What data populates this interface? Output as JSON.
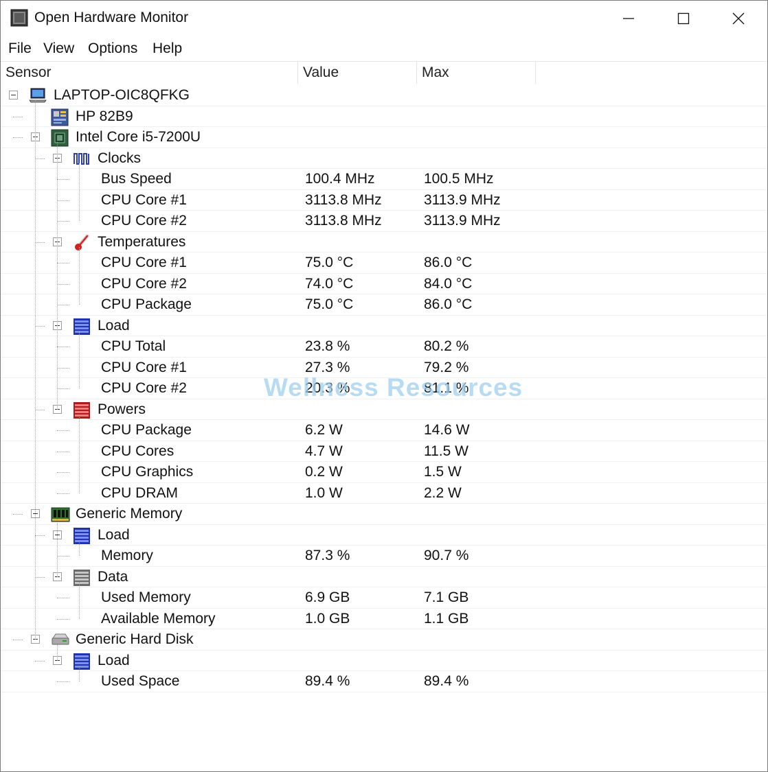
{
  "window": {
    "title": "Open Hardware Monitor",
    "controls": {
      "minimize": "minimize",
      "maximize": "maximize",
      "close": "close"
    }
  },
  "menu": [
    "File",
    "View",
    "Options",
    "Help"
  ],
  "columns": [
    "Sensor",
    "Value",
    "Max"
  ],
  "tree": [
    {
      "label": "LAPTOP-OIC8QFKG",
      "icon": "computer-icon",
      "level": 0,
      "expandable": true
    },
    {
      "label": "HP 82B9",
      "icon": "motherboard-icon",
      "level": 1,
      "expandable": false
    },
    {
      "label": "Intel Core i5-7200U",
      "icon": "cpu-chip-icon",
      "level": 1,
      "expandable": true
    },
    {
      "label": "Clocks",
      "icon": "clock-wave-icon",
      "level": 2,
      "expandable": true
    },
    {
      "label": "Bus Speed",
      "level": 3,
      "value": "100.4 MHz",
      "max": "100.5 MHz"
    },
    {
      "label": "CPU Core #1",
      "level": 3,
      "value": "3113.8 MHz",
      "max": "3113.9 MHz"
    },
    {
      "label": "CPU Core #2",
      "level": 3,
      "value": "3113.8 MHz",
      "max": "3113.9 MHz"
    },
    {
      "label": "Temperatures",
      "icon": "thermometer-icon",
      "level": 2,
      "expandable": true
    },
    {
      "label": "CPU Core #1",
      "level": 3,
      "value": "75.0 °C",
      "max": "86.0 °C"
    },
    {
      "label": "CPU Core #2",
      "level": 3,
      "value": "74.0 °C",
      "max": "84.0 °C"
    },
    {
      "label": "CPU Package",
      "level": 3,
      "value": "75.0 °C",
      "max": "86.0 °C"
    },
    {
      "label": "Load",
      "icon": "load-bars-blue-icon",
      "level": 2,
      "expandable": true
    },
    {
      "label": "CPU Total",
      "level": 3,
      "value": "23.8 %",
      "max": "80.2 %"
    },
    {
      "label": "CPU Core #1",
      "level": 3,
      "value": "27.3 %",
      "max": "79.2 %"
    },
    {
      "label": "CPU Core #2",
      "level": 3,
      "value": "20.3 %",
      "max": "81.1 %"
    },
    {
      "label": "Powers",
      "icon": "power-bars-red-icon",
      "level": 2,
      "expandable": true
    },
    {
      "label": "CPU Package",
      "level": 3,
      "value": "6.2 W",
      "max": "14.6 W"
    },
    {
      "label": "CPU Cores",
      "level": 3,
      "value": "4.7 W",
      "max": "11.5 W"
    },
    {
      "label": "CPU Graphics",
      "level": 3,
      "value": "0.2 W",
      "max": "1.5 W"
    },
    {
      "label": "CPU DRAM",
      "level": 3,
      "value": "1.0 W",
      "max": "2.2 W"
    },
    {
      "label": "Generic Memory",
      "icon": "ram-module-icon",
      "level": 1,
      "expandable": true
    },
    {
      "label": "Load",
      "icon": "load-bars-blue-icon",
      "level": 2,
      "expandable": true
    },
    {
      "label": "Memory",
      "level": 3,
      "value": "87.3 %",
      "max": "90.7 %"
    },
    {
      "label": "Data",
      "icon": "data-bars-gray-icon",
      "level": 2,
      "expandable": true
    },
    {
      "label": "Used Memory",
      "level": 3,
      "value": "6.9 GB",
      "max": "7.1 GB"
    },
    {
      "label": "Available Memory",
      "level": 3,
      "value": "1.0 GB",
      "max": "1.1 GB"
    },
    {
      "label": "Generic Hard Disk",
      "icon": "hard-disk-icon",
      "level": 1,
      "expandable": true
    },
    {
      "label": "Load",
      "icon": "load-bars-blue-icon",
      "level": 2,
      "expandable": true
    },
    {
      "label": "Used Space",
      "level": 3,
      "value": "89.4 %",
      "max": "89.4 %"
    }
  ],
  "watermark": "Wellness Resources",
  "colors": {
    "load": "#2f4fd0",
    "power": "#c02020",
    "data": "#7a7a7a",
    "accent": "#1f3fc0"
  }
}
